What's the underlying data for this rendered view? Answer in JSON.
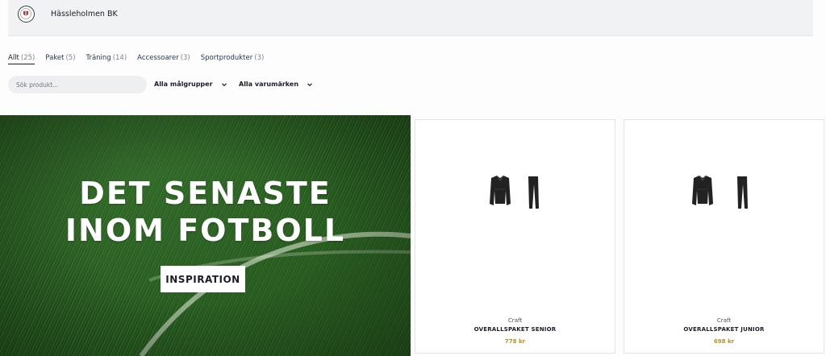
{
  "header": {
    "club_name": "Hässleholmen BK",
    "logo_icon": "club-crest-icon"
  },
  "tabs": [
    {
      "label": "Allt",
      "count": "(25)",
      "active": true
    },
    {
      "label": "Paket",
      "count": "(5)",
      "active": false
    },
    {
      "label": "Träning",
      "count": "(14)",
      "active": false
    },
    {
      "label": "Accessoarer",
      "count": "(3)",
      "active": false
    },
    {
      "label": "Sportprodukter",
      "count": "(3)",
      "active": false
    }
  ],
  "filters": {
    "search_placeholder": "Sök produkt...",
    "target_group": "Alla målgrupper",
    "brand": "Alla varumärken"
  },
  "hero": {
    "title_line1": "DET SENASTE",
    "title_line2": "INOM FOTBOLL",
    "button_label": "INSPIRATION"
  },
  "products": [
    {
      "brand": "Craft",
      "title": "OVERALLSPAKET SENIOR",
      "price": "778 kr"
    },
    {
      "brand": "Craft",
      "title": "OVERALLSPAKET JUNIOR",
      "price": "698 kr"
    }
  ],
  "colors": {
    "price": "#b8902a",
    "header_bg": "#f1f2f4",
    "tab_link": "#1f3a66"
  }
}
